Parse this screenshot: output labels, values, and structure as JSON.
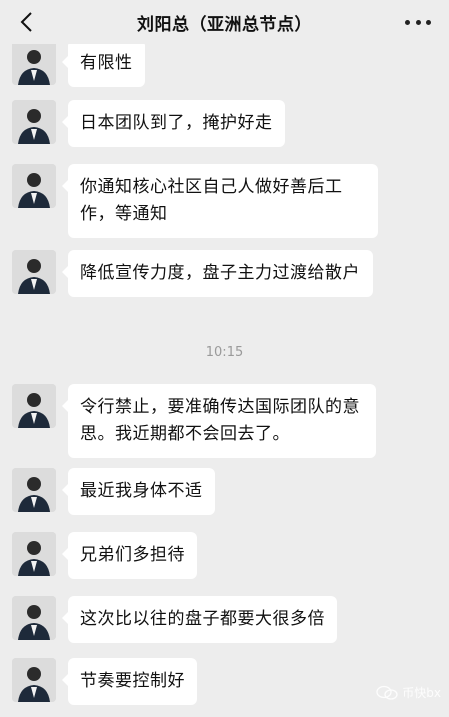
{
  "header": {
    "title": "刘阳总（亚洲总节点）"
  },
  "messages": [
    {
      "text": "有限性"
    },
    {
      "text": "日本团队到了，掩护好走"
    },
    {
      "text": "你通知核心社区自己人做好善后工作，等通知"
    },
    {
      "text": "降低宣传力度，盘子主力过渡给散户"
    },
    {
      "text": "令行禁止，要准确传达国际团队的意思。我近期都不会回去了。"
    },
    {
      "text": "最近我身体不适"
    },
    {
      "text": "兄弟们多担待"
    },
    {
      "text": "这次比以往的盘子都要大很多倍"
    },
    {
      "text": "节奏要控制好"
    }
  ],
  "timestamp": "10:15",
  "watermark": "币快bx",
  "colors": {
    "background": "#ededed",
    "bubble": "#ffffff",
    "text": "#111111"
  }
}
